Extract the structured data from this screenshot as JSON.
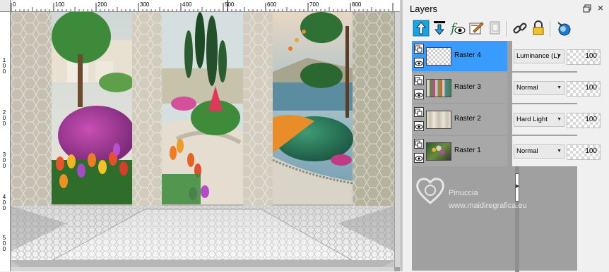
{
  "panel": {
    "title": "Layers",
    "window_icon": "window-restore-icon",
    "close_icon": "close-icon"
  },
  "toolbar": [
    {
      "name": "move-layer-up-icon",
      "tooltip": "Move layer up"
    },
    {
      "name": "move-layer-down-icon",
      "tooltip": "Move layer down"
    },
    {
      "name": "visibility-toggle-icon",
      "tooltip": "Toggle visibility"
    },
    {
      "name": "edit-selection-icon",
      "tooltip": "Edit selection"
    },
    {
      "name": "new-layer-icon",
      "tooltip": "New layer"
    },
    {
      "name": "link-layers-icon",
      "tooltip": "Link layers"
    },
    {
      "name": "lock-transparency-icon",
      "tooltip": "Lock transparency"
    },
    {
      "name": "mask-icon",
      "tooltip": "Layer mask"
    }
  ],
  "layers": [
    {
      "name": "Raster 4",
      "blend_mode": "Luminance (L)",
      "opacity": "100",
      "selected": true
    },
    {
      "name": "Raster 3",
      "blend_mode": "Normal",
      "opacity": "100",
      "selected": false
    },
    {
      "name": "Raster 2",
      "blend_mode": "Hard Light",
      "opacity": "100",
      "selected": false
    },
    {
      "name": "Raster 1",
      "blend_mode": "Normal",
      "opacity": "100",
      "selected": false
    }
  ],
  "ruler": {
    "top_labels": [
      "0",
      "100",
      "200",
      "300",
      "400",
      "500",
      "600",
      "700",
      "800"
    ],
    "left_labels": [
      "1\n0\n0",
      "2\n0\n0",
      "3\n0\n0",
      "4\n0\n0",
      "5\n0\n0"
    ]
  },
  "watermark": {
    "line1": "Pinuccia",
    "line2": "www.maidiregrafica.eu"
  },
  "colors": {
    "selection": "#3a9bff",
    "layer_bg": "#a8a8a8",
    "canvas_bg": "#a0a0a0"
  }
}
